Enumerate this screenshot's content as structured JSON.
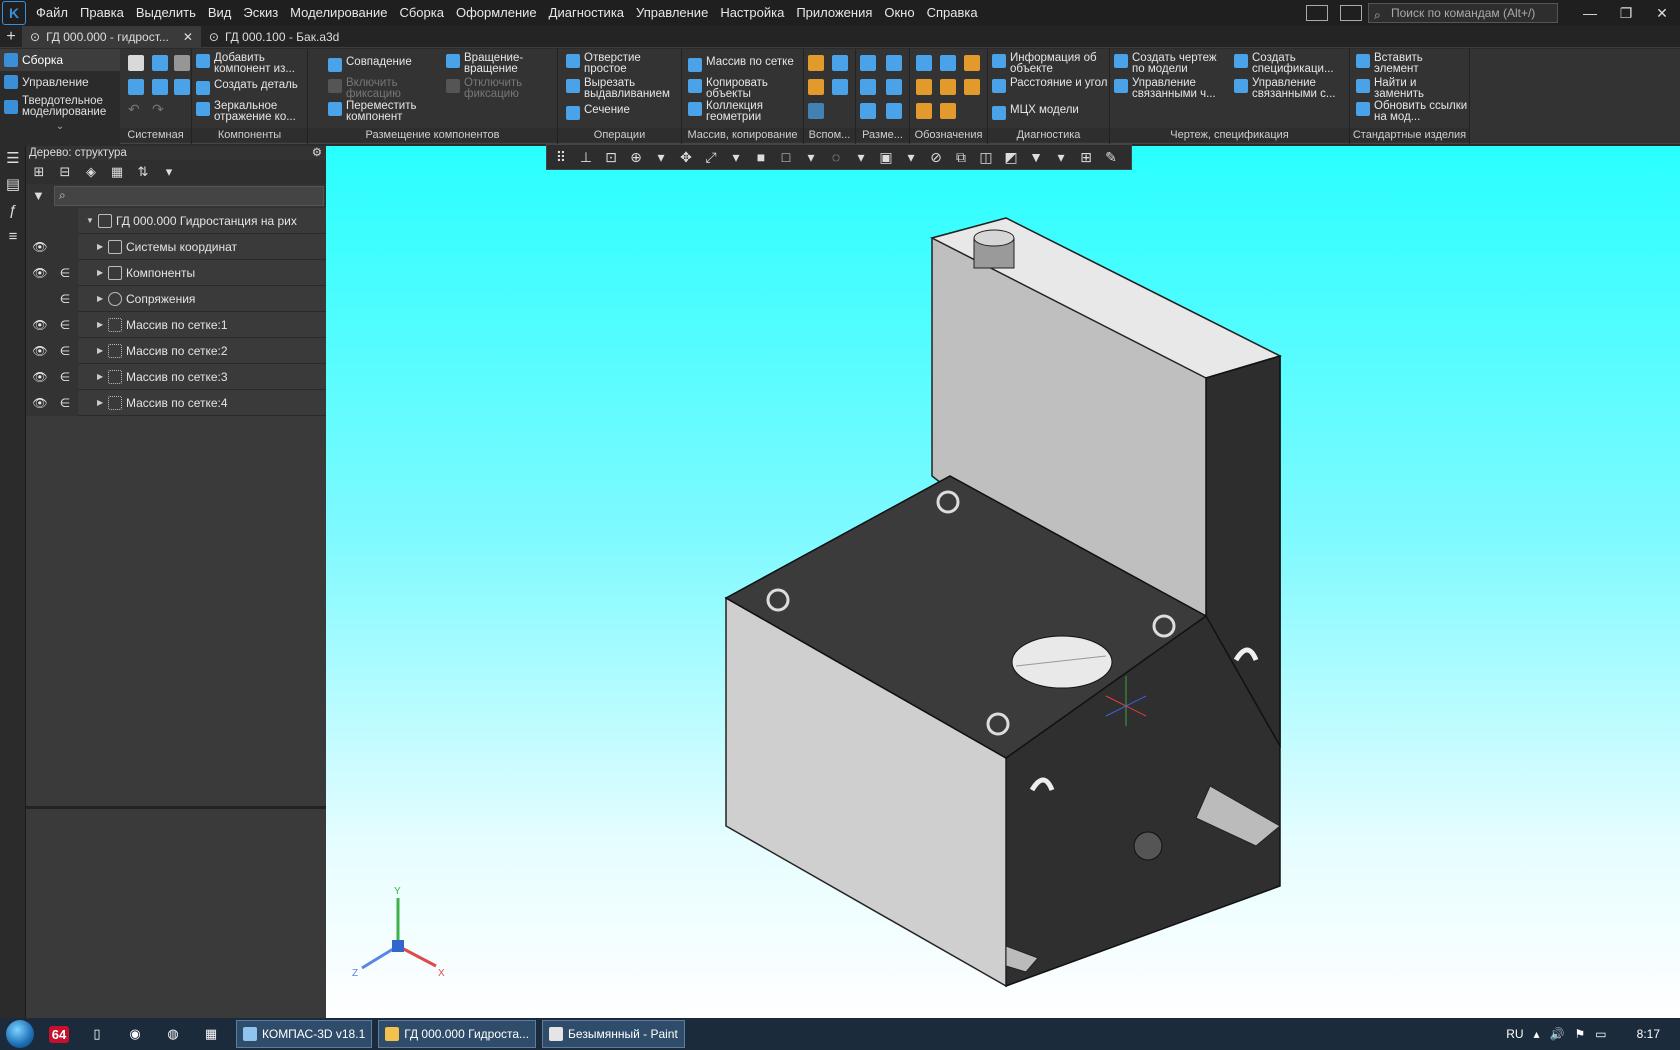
{
  "menu": [
    "Файл",
    "Правка",
    "Выделить",
    "Вид",
    "Эскиз",
    "Моделирование",
    "Сборка",
    "Оформление",
    "Диагностика",
    "Управление",
    "Настройка",
    "Приложения",
    "Окно",
    "Справка"
  ],
  "search": {
    "placeholder": "Поиск по командам (Alt+/)"
  },
  "tabs": [
    {
      "label": "ГД 000.000 - гидрост...",
      "active": true
    },
    {
      "label": "ГД 000.100 - Бак.a3d",
      "active": false
    }
  ],
  "ribbon_left": [
    "Сборка",
    "Управление",
    "Твердотельное моделирование"
  ],
  "ribbon": {
    "groups": [
      "Системная",
      "Компоненты",
      "Размещение компонентов",
      "Операции",
      "Массив, копирование",
      "Вспом...",
      "Разме...",
      "Обозначения",
      "Диагностика",
      "Чертеж, спецификация",
      "Стандартные изделия"
    ],
    "components": [
      "Добавить компонент из...",
      "Создать деталь",
      "Зеркальное отражение ко..."
    ],
    "placement": [
      "Совпадение",
      "Включить фиксацию",
      "Переместить компонент",
      "Вращение-вращение",
      "Отключить фиксацию"
    ],
    "operations": [
      "Отверстие простое",
      "Вырезать выдавливанием",
      "Сечение"
    ],
    "array": [
      "Массив по сетке",
      "Копировать объекты",
      "Коллекция геометрии"
    ],
    "diagnostics": [
      "Информация об объекте",
      "Расстояние и угол",
      "МЦХ модели"
    ],
    "drawing": [
      "Создать чертеж по модели",
      "Управление связанными ч...",
      "Создать спецификаци...",
      "Управление связанными с..."
    ],
    "standard": [
      "Вставить элемент",
      "Найти и заменить",
      "Обновить ссылки на мод..."
    ]
  },
  "tree": {
    "title": "Дерево: структура",
    "root": "ГД 000.000 Гидростанция на рих",
    "items": [
      "Системы координат",
      "Компоненты",
      "Сопряжения",
      "Массив по сетке:1",
      "Массив по сетке:2",
      "Массив по сетке:3",
      "Массив по сетке:4"
    ]
  },
  "axes": {
    "x": "X",
    "y": "Y",
    "z": "Z"
  },
  "taskbar": {
    "tasks": [
      "КОМПАС-3D v18.1",
      "ГД 000.000 Гидроста...",
      "Безымянный - Paint"
    ],
    "badge": "64",
    "lang": "RU",
    "time": "8:17"
  }
}
